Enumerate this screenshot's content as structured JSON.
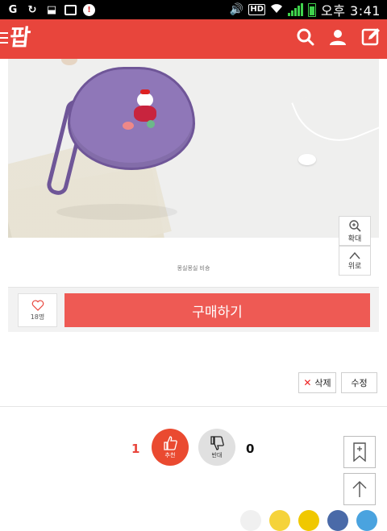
{
  "status_bar": {
    "time": "오후 3:41",
    "hd_label": "HD",
    "icons": [
      "g-icon",
      "refresh-icon",
      "download-icon",
      "image-icon",
      "notification-icon",
      "volume-icon",
      "wifi-icon",
      "signal-icon",
      "battery-icon"
    ]
  },
  "app": {
    "logo_text": "팝",
    "header_icons": [
      "search-icon",
      "user-icon",
      "write-icon"
    ],
    "brand_color": "#e8453c"
  },
  "product": {
    "caption": "몽실몽실 비숑",
    "zoom_in_label": "확대",
    "to_top_label": "위로"
  },
  "buy_bar": {
    "like_count": "18명",
    "buy_label": "구매하기",
    "buy_color": "#ee5a54"
  },
  "actions": {
    "delete_label": "삭제",
    "edit_label": "수정"
  },
  "vote": {
    "up_count": "1",
    "up_label": "추천",
    "down_count": "0",
    "down_label": "반대"
  }
}
